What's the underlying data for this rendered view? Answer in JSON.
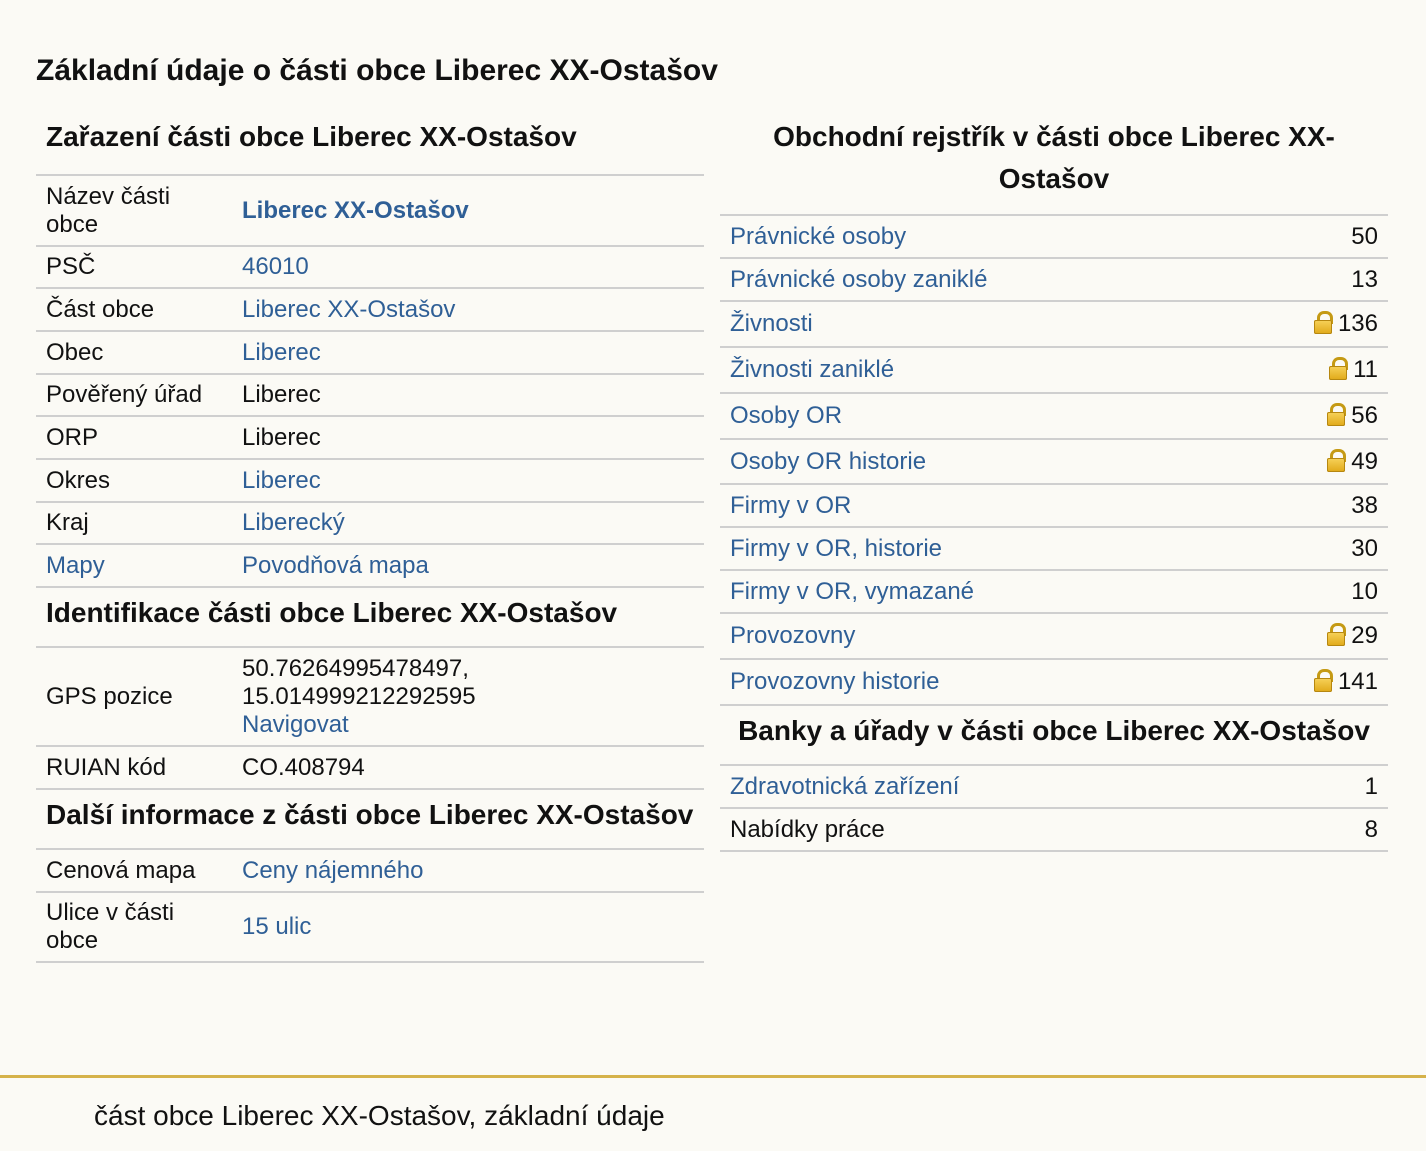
{
  "page_title": "Základní údaje o části obce Liberec XX-Ostašov",
  "zarazeni": {
    "heading": "Zařazení části obce Liberec XX-Ostašov",
    "rows": [
      {
        "label": "Název části obce",
        "value": "Liberec XX-Ostašov"
      },
      {
        "label": "PSČ",
        "value": "46010"
      },
      {
        "label": "Část obce",
        "value": "Liberec XX-Ostašov"
      },
      {
        "label": "Obec",
        "value": "Liberec"
      },
      {
        "label": "Pověřený úřad",
        "value": "Liberec"
      },
      {
        "label": "ORP",
        "value": "Liberec"
      },
      {
        "label": "Okres",
        "value": "Liberec"
      },
      {
        "label": "Kraj",
        "value": "Liberecký"
      },
      {
        "label": "Mapy",
        "value": "Povodňová mapa"
      }
    ]
  },
  "identifikace": {
    "heading": "Identifikace části obce Liberec XX-Ostašov",
    "gps_label": "GPS pozice",
    "gps_lat": "50.76264995478497,",
    "gps_lon": "15.014999212292595",
    "navigate": "Navigovat",
    "ruian_label": "RUIAN kód",
    "ruian_value": "CO.408794"
  },
  "dalsi": {
    "heading": "Další informace z části obce Liberec XX-Ostašov",
    "rows": [
      {
        "label": "Cenová mapa",
        "value": "Ceny nájemného"
      },
      {
        "label": "Ulice v části obce",
        "value": "15 ulic"
      }
    ]
  },
  "rejstrik": {
    "heading": "Obchodní rejstřík v části obce Liberec XX-Ostašov",
    "rows": [
      {
        "label": "Právnické osoby",
        "value": "50",
        "locked": false
      },
      {
        "label": "Právnické osoby zaniklé",
        "value": "13",
        "locked": false
      },
      {
        "label": "Živnosti",
        "value": "136",
        "locked": true
      },
      {
        "label": "Živnosti zaniklé",
        "value": "11",
        "locked": true
      },
      {
        "label": "Osoby OR",
        "value": "56",
        "locked": true
      },
      {
        "label": "Osoby OR historie",
        "value": "49",
        "locked": true
      },
      {
        "label": "Firmy v OR",
        "value": "38",
        "locked": false
      },
      {
        "label": "Firmy v OR, historie",
        "value": "30",
        "locked": false
      },
      {
        "label": "Firmy v OR, vymazané",
        "value": "10",
        "locked": false
      },
      {
        "label": "Provozovny",
        "value": "29",
        "locked": true
      },
      {
        "label": "Provozovny historie",
        "value": "141",
        "locked": true
      }
    ]
  },
  "banky": {
    "heading": "Banky a úřady v části obce Liberec XX-Ostašov",
    "rows": [
      {
        "label": "Zdravotnická zařízení",
        "value": "1"
      },
      {
        "label": "Nabídky práce",
        "value": "8"
      }
    ]
  },
  "footer": {
    "text": "část obce Liberec XX-Ostašov, základní údaje"
  },
  "colors": {
    "link": "#2f5f96",
    "footer_rule": "#d5b24a",
    "lock": "#e0a818"
  },
  "icons": {
    "lock": "lock-icon"
  }
}
